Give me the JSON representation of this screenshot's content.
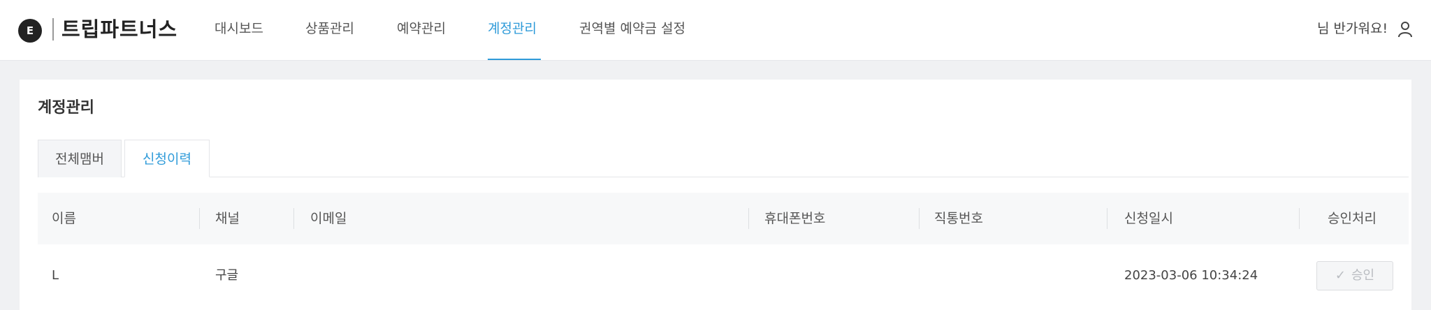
{
  "brand": {
    "logo_letter": "E",
    "name": "트립파트너스"
  },
  "nav": {
    "items": [
      {
        "label": "대시보드"
      },
      {
        "label": "상품관리"
      },
      {
        "label": "예약관리"
      },
      {
        "label": "계정관리"
      },
      {
        "label": "권역별 예약금 설정"
      }
    ],
    "active_index": 3,
    "greeting": "님 반가워요!",
    "user_icon": "user-icon"
  },
  "page": {
    "title": "계정관리",
    "tabs": [
      {
        "label": "전체맴버",
        "active": false
      },
      {
        "label": "신청이력",
        "active": true
      }
    ]
  },
  "table": {
    "columns": [
      "이름",
      "채널",
      "이메일",
      "휴대폰번호",
      "직통번호",
      "신청일시",
      "승인처리"
    ],
    "rows": [
      {
        "name": "L",
        "channel": "구글",
        "email": "",
        "mobile": "",
        "direct": "",
        "applied_at": "2023-03-06 10:34:24",
        "action_label": "승인",
        "action_icon": "check-icon",
        "action_disabled": true
      }
    ]
  },
  "colors": {
    "accent": "#2f9bd9",
    "background": "#f0f1f3",
    "disabled_text": "#b9bcc1"
  }
}
